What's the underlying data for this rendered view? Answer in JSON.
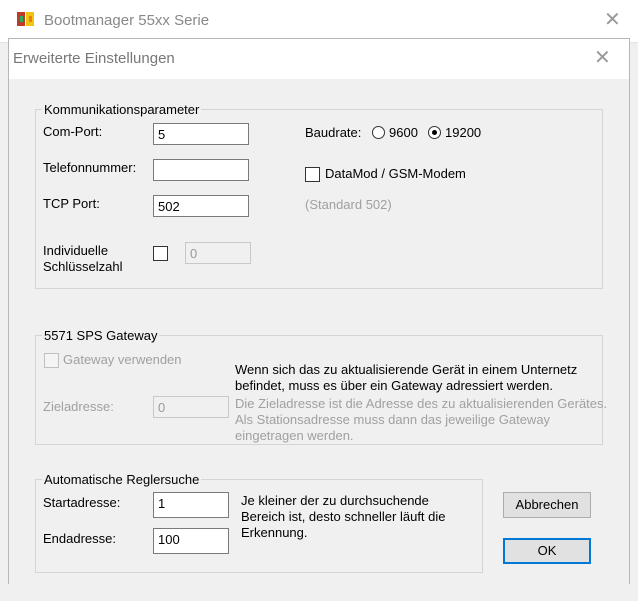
{
  "outer_window": {
    "title": "Bootmanager 55xx Serie",
    "close_glyph": "✕"
  },
  "dialog": {
    "title": "Erweiterte Einstellungen",
    "close_glyph": "✕",
    "kommunikation": {
      "group_label": "Kommunikationsparameter",
      "comport_label": "Com-Port:",
      "comport_value": "5",
      "telefon_label": "Telefonnummer:",
      "telefon_value": "",
      "tcp_label": "TCP Port:",
      "tcp_value": "502",
      "tcp_hint": "(Standard 502)",
      "baudrate_label": "Baudrate:",
      "baud_9600": "9600",
      "baud_19200": "19200",
      "baud_selected": "19200",
      "datamod_label": "DataMod / GSM-Modem",
      "datamod_checked": false,
      "key_label_1": "Individuelle",
      "key_label_2": "Schlüsselzahl",
      "key_checked": false,
      "key_value": "0"
    },
    "gateway": {
      "group_label": "5571 SPS Gateway",
      "use_label": "Gateway verwenden",
      "use_checked": false,
      "info_1": "Wenn sich das zu aktualisierende Gerät in einem Unternetz",
      "info_2": "befindet, muss es über ein Gateway adressiert werden.",
      "ziel_label": "Zieladresse:",
      "ziel_value": "0",
      "ziel_info_1": "Die Zieladresse ist die Adresse des zu aktualisierenden Gerätes.",
      "ziel_info_2": "Als Stationsadresse muss dann das jeweilige Gateway",
      "ziel_info_3": "eingetragen werden."
    },
    "reglersuche": {
      "group_label": "Automatische Reglersuche",
      "start_label": "Startadresse:",
      "start_value": "1",
      "end_label": "Endadresse:",
      "end_value": "100",
      "info_1": "Je kleiner der zu durchsuchende",
      "info_2": "Bereich ist, desto schneller läuft die",
      "info_3": "Erkennung."
    },
    "buttons": {
      "cancel": "Abbrechen",
      "ok": "OK"
    }
  },
  "colors": {
    "window_bg": "#f0f0f0",
    "accent": "#0078d7"
  }
}
